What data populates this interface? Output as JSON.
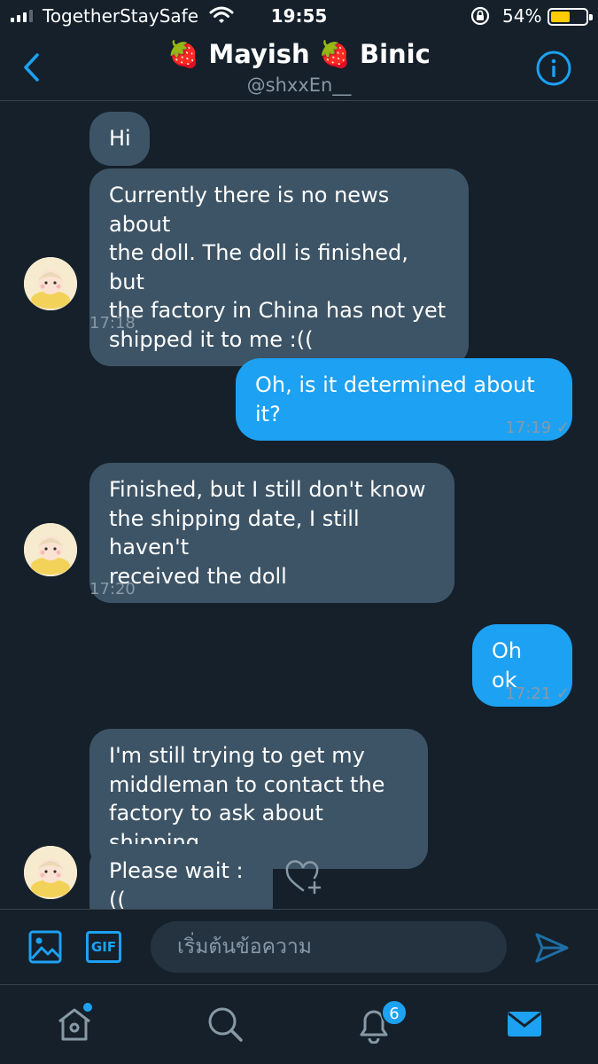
{
  "status_bar": {
    "carrier": "TogetherStaySafe",
    "time": "19:55",
    "battery_percent": "54%",
    "battery_level": 0.54,
    "battery_color": "#ffcc00"
  },
  "header": {
    "title": "🍓 Mayish 🍓 Binic",
    "handle": "@shxxEn__"
  },
  "messages": [
    {
      "side": "in",
      "text": "Hi"
    },
    {
      "side": "in",
      "text": "Currently there is no news about\nthe doll.  The doll is finished, but\nthe factory in China has not yet\nshipped it to me :(("
    },
    {
      "side": "in_time",
      "text": "17:18"
    },
    {
      "side": "out",
      "text": "Oh, is it determined about it?"
    },
    {
      "side": "out_time",
      "text": "17:19 ✓"
    },
    {
      "side": "in",
      "text": "Finished, but I still don't know\nthe shipping date, I still haven't\nreceived the doll"
    },
    {
      "side": "in_time",
      "text": "17:20"
    },
    {
      "side": "out",
      "text": "Oh ok"
    },
    {
      "side": "out_time",
      "text": "17:21 ✓"
    },
    {
      "side": "in",
      "text": "I'm still trying to get my\nmiddleman to contact the\nfactory to ask about shipping"
    },
    {
      "side": "in",
      "text": "Please wait :(("
    }
  ],
  "composer": {
    "gif_label": "GIF",
    "placeholder": "เริ่มต้นข้อความ"
  },
  "tabbar": {
    "notification_count": "6"
  },
  "colors": {
    "background": "#15202b",
    "accent": "#1da1f2",
    "incoming_bubble": "#3d5466",
    "muted_text": "#8899a6"
  }
}
